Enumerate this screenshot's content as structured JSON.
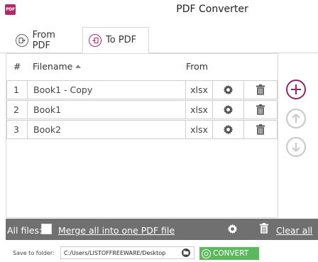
{
  "window": {
    "title": "PDF Converter",
    "app_icon_text": "PDF"
  },
  "tabs": [
    {
      "label": "From PDF",
      "active": false
    },
    {
      "label": "To PDF",
      "active": true
    }
  ],
  "table": {
    "columns": {
      "num": "#",
      "filename": "Filename",
      "from": "From"
    },
    "rows": [
      {
        "num": "1",
        "filename": "Book1 - Copy",
        "from": "xlsx"
      },
      {
        "num": "2",
        "filename": "Book1",
        "from": "xlsx"
      },
      {
        "num": "3",
        "filename": "Book2",
        "from": "xlsx"
      }
    ]
  },
  "side_buttons": {
    "add": "add-icon",
    "up": "arrow-up-icon",
    "down": "arrow-down-icon"
  },
  "bottom_bar": {
    "all_files_label": "All files:",
    "merge_label": "Merge all into one PDF file",
    "clear_all_label": "Clear all"
  },
  "footer": {
    "save_label": "Save to folder:",
    "path_value": "C:/Users/LISTOFFREEWARE/Desktop",
    "convert_label": "CONVERT"
  },
  "colors": {
    "accent": "#8a2a6a",
    "convert": "#5cb85c",
    "bar": "#707070"
  }
}
